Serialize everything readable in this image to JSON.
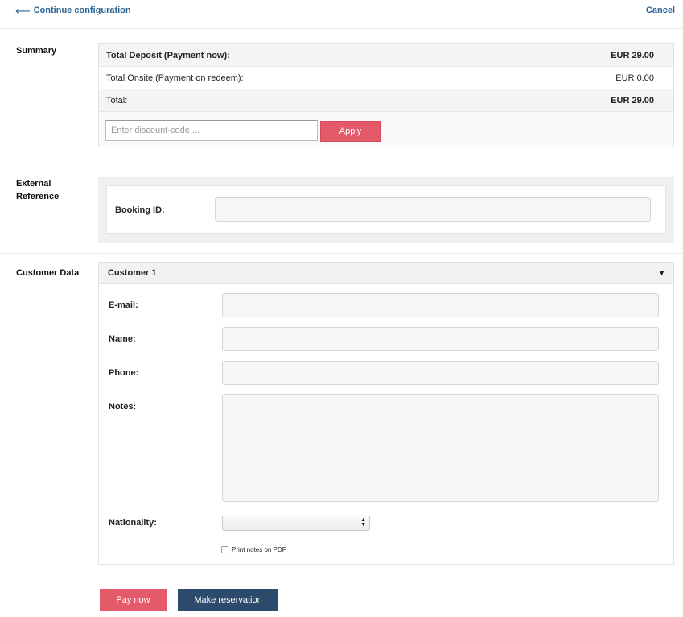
{
  "header": {
    "back_arrow": "⟵",
    "back_label": "Continue configuration",
    "cancel_label": "Cancel"
  },
  "summary": {
    "section_label": "Summary",
    "rows": [
      {
        "label": "Total Deposit (Payment now):",
        "value": "EUR 29.00"
      },
      {
        "label": "Total Onsite (Payment on redeem):",
        "value": "EUR 0.00"
      },
      {
        "label": "Total:",
        "value": "EUR 29.00"
      }
    ],
    "discount_placeholder": "Enter discount-code ...",
    "discount_value": "",
    "apply_label": "Apply"
  },
  "external_reference": {
    "section_label_line1": "External",
    "section_label_line2": "Reference",
    "booking_label": "Booking ID:",
    "booking_value": ""
  },
  "customer_data": {
    "section_label": "Customer Data",
    "customer_title": "Customer 1",
    "caret": "▼",
    "fields": {
      "email_label": "E-mail:",
      "name_label": "Name:",
      "phone_label": "Phone:",
      "notes_label": "Notes:",
      "nationality_label": "Nationality:"
    },
    "nationality_value": "",
    "print_notes_label": "Print notes on PDF"
  },
  "actions": {
    "pay_now_label": "Pay now",
    "make_reservation_label": "Make reservation"
  },
  "colors": {
    "link": "#2a6496",
    "primary_red": "#e55a6a",
    "navy": "#2c4a6b"
  },
  "icons": {
    "back": "arrow-left-icon",
    "collapse": "caret-down-icon",
    "select": "updown-icon"
  }
}
